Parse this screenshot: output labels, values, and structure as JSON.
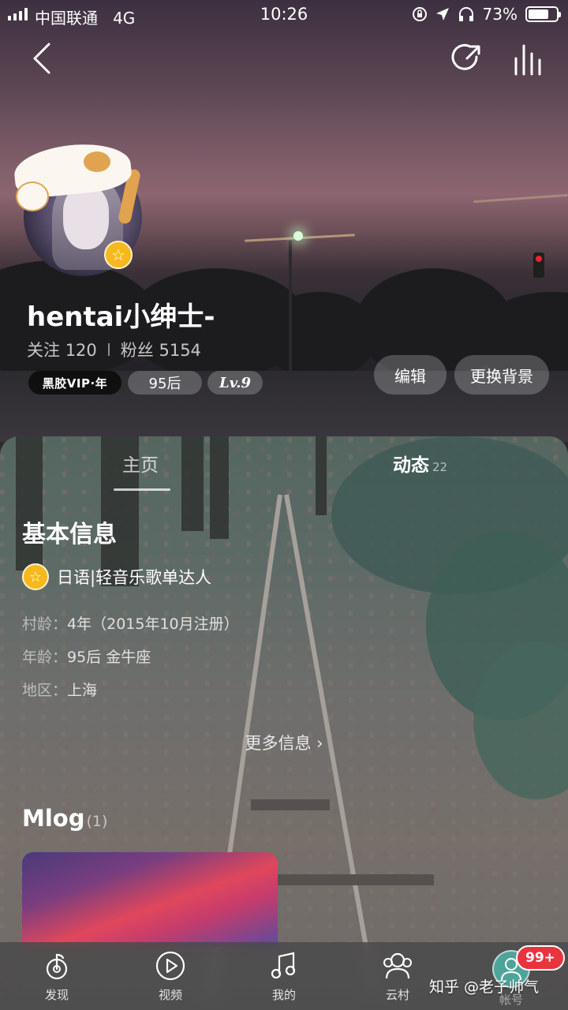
{
  "status_bar": {
    "carrier": "中国联通",
    "network": "4G",
    "time": "10:26",
    "battery_percent": "73%",
    "battery_level": 0.73
  },
  "profile": {
    "username": "hentai小绅士-",
    "following_label": "关注",
    "following_count": "120",
    "followers_label": "粉丝",
    "followers_count": "5154",
    "vip_badge": "黑胶VIP·年",
    "age_tag": "95后",
    "level": "Lv.9",
    "edit_button": "编辑",
    "change_bg_button": "更换背景"
  },
  "tabs": {
    "home": "主页",
    "feed": "动态",
    "feed_count": "22"
  },
  "basic_info": {
    "title": "基本信息",
    "badge_text": "日语|轻音乐歌单达人",
    "village_age_label": "村龄：",
    "village_age_value": "4年（2015年10月注册）",
    "age_label": "年龄：",
    "age_value": "95后 金牛座",
    "region_label": "地区：",
    "region_value": "上海",
    "more_info": "更多信息 ›"
  },
  "mlog": {
    "title": "Mlog",
    "count": "(1)"
  },
  "bottom_nav": {
    "discover": "发现",
    "video": "视频",
    "mine": "我的",
    "village": "云村",
    "account": "帐号",
    "notification_badge": "99+"
  },
  "watermark": "知乎 @老子帅气",
  "colors": {
    "star_gold": "#f6b81f",
    "badge_red": "#e8343c",
    "account_teal": "#4fa49a"
  }
}
